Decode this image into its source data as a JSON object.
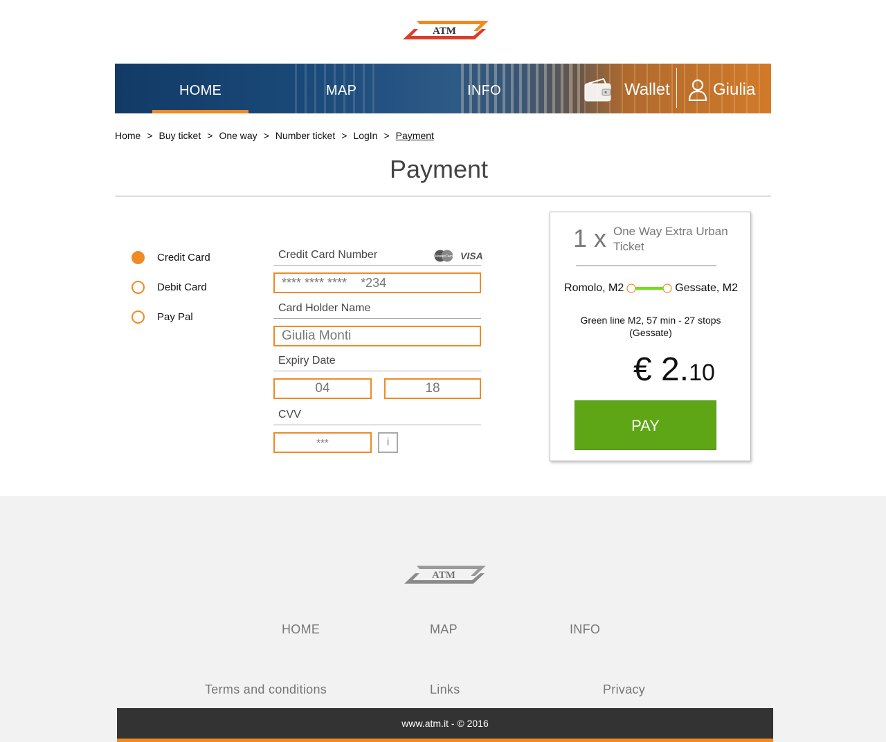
{
  "brand": {
    "logo_text": "ATM",
    "accent": "#ef8a22",
    "logo_red": "#d9402a"
  },
  "nav": {
    "home": "HOME",
    "map": "MAP",
    "info": "INFO",
    "wallet": "Wallet",
    "user": "Giulia"
  },
  "breadcrumb": [
    "Home",
    "Buy ticket",
    "One way",
    "Number ticket",
    "LogIn",
    "Payment"
  ],
  "breadcrumb_sep": ">",
  "page_title": "Payment",
  "payment_methods": [
    {
      "label": "Credit Card",
      "selected": true
    },
    {
      "label": "Debit Card",
      "selected": false
    },
    {
      "label": "Pay Pal",
      "selected": false
    }
  ],
  "form": {
    "card_number_label": "Credit Card Number",
    "card_number_value": "**** **** ****    *234",
    "card_brands": [
      "MasterCard",
      "VISA"
    ],
    "holder_label": "Card Holder Name",
    "holder_value": "Giulia Monti",
    "expiry_label": "Expiry Date",
    "expiry_month": "04",
    "expiry_year": "18",
    "cvv_label": "CVV",
    "cvv_value": "***",
    "info_button": "i"
  },
  "summary": {
    "quantity": "1 x",
    "ticket_name": "One Way Extra Urban Ticket",
    "from": "Romolo, M2",
    "to": "Gessate, M2",
    "route_desc": "Green line M2, 57 min - 27 stops (Gessate)",
    "price_main": "€ 2.",
    "price_cents": "10",
    "pay_label": "PAY",
    "pay_color": "#5ea615",
    "line_color": "#6fe01a"
  },
  "footer": {
    "logo_text": "ATM",
    "nav": [
      "HOME",
      "MAP",
      "INFO"
    ],
    "links": [
      "Terms and conditions",
      "Links",
      "Privacy"
    ],
    "copyright": "www.atm.it - © 2016"
  }
}
